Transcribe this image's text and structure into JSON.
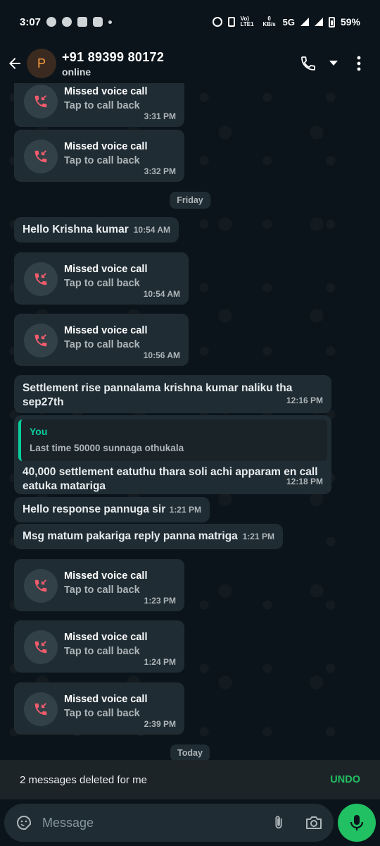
{
  "status_bar": {
    "time": "3:07",
    "network_label": "Vo) LTE1",
    "data_rate": "0 KB/s",
    "network_type": "5G",
    "battery": "59%"
  },
  "header": {
    "avatar_letter": "P",
    "contact_name": "+91 89399 80172",
    "contact_status": "online"
  },
  "messages": [
    {
      "kind": "call",
      "title": "Missed voice call",
      "sub": "Tap to call back",
      "time": "3:31 PM"
    },
    {
      "kind": "call",
      "title": "Missed voice call",
      "sub": "Tap to call back",
      "time": "3:32 PM"
    },
    {
      "kind": "date",
      "label": "Friday"
    },
    {
      "kind": "text",
      "text": "Hello Krishna kumar",
      "time": "10:54 AM"
    },
    {
      "kind": "call",
      "title": "Missed voice call",
      "sub": "Tap to call back",
      "time": "10:54 AM"
    },
    {
      "kind": "call",
      "title": "Missed voice call",
      "sub": "Tap to call back",
      "time": "10:56 AM"
    },
    {
      "kind": "text",
      "text": "Settlement rise pannalama krishna kumar naliku tha sep27th",
      "time": "12:16 PM"
    },
    {
      "kind": "reply",
      "quote_author": "You",
      "quote_text": "Last time 50000 sunnaga othukala",
      "text": "40,000 settlement eatuthu thara soli achi apparam en call eatuka matariga",
      "time": "12:18 PM"
    },
    {
      "kind": "text",
      "text": "Hello response pannuga sir",
      "time": "1:21 PM"
    },
    {
      "kind": "text",
      "text": "Msg matum pakariga reply panna matriga",
      "time": "1:21 PM"
    },
    {
      "kind": "call",
      "title": "Missed voice call",
      "sub": "Tap to call back",
      "time": "1:23 PM"
    },
    {
      "kind": "call",
      "title": "Missed voice call",
      "sub": "Tap to call back",
      "time": "1:24 PM"
    },
    {
      "kind": "call",
      "title": "Missed voice call",
      "sub": "Tap to call back",
      "time": "2:39 PM"
    },
    {
      "kind": "date",
      "label": "Today"
    }
  ],
  "snackbar": {
    "text": "2 messages deleted for me",
    "action": "UNDO"
  },
  "composer": {
    "placeholder": "Message"
  },
  "icons": {
    "back": "arrow-left-icon",
    "call": "phone-icon",
    "dropdown": "caret-down-icon",
    "menu": "more-vertical-icon",
    "missed_call": "missed-call-icon",
    "emoji": "sticker-icon",
    "attach": "paperclip-icon",
    "camera": "camera-icon",
    "mic": "mic-icon"
  },
  "colors": {
    "accent_green": "#21c063",
    "quote_bar": "#06cf9c",
    "missed_red": "#f15c6d",
    "bubble": "#1f2c33"
  }
}
